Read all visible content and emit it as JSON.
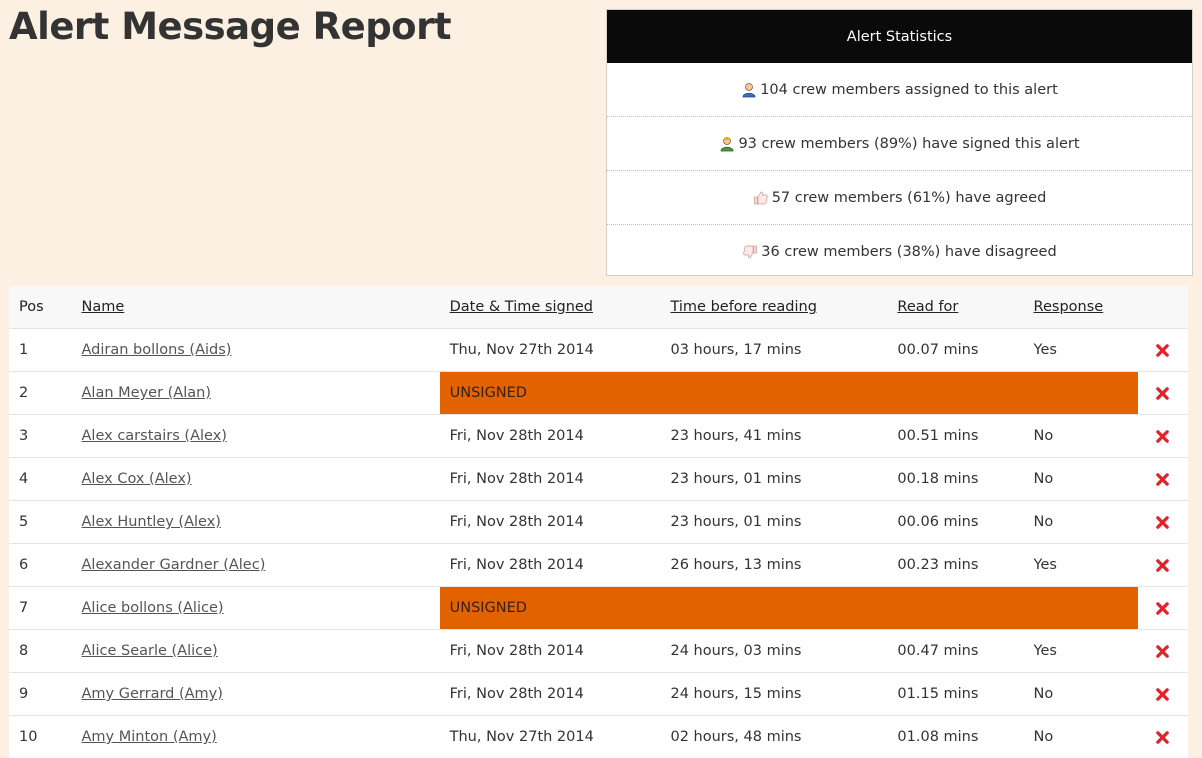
{
  "page": {
    "title": "Alert Message Report"
  },
  "stats": {
    "header": "Alert Statistics",
    "rows": [
      {
        "icon": "user-icon",
        "text": "104 crew members assigned to this alert"
      },
      {
        "icon": "signed-user-icon",
        "text": "93 crew members (89%) have signed this alert"
      },
      {
        "icon": "thumbs-up-icon",
        "text": "57 crew members (61%) have agreed"
      },
      {
        "icon": "thumbs-down-icon",
        "text": "36 crew members (38%) have disagreed"
      }
    ]
  },
  "table": {
    "columns": [
      "Pos",
      "Name",
      "Date & Time signed",
      "Time before reading",
      "Read for",
      "Response"
    ],
    "unsigned_label": "UNSIGNED",
    "rows": [
      {
        "pos": "1",
        "name": "Adiran bollons (Aids)",
        "date": "Thu, Nov 27th 2014",
        "before": "03 hours, 17 mins",
        "read": "00.07 mins",
        "response": "Yes"
      },
      {
        "pos": "2",
        "name": "Alan Meyer (Alan)",
        "unsigned": true
      },
      {
        "pos": "3",
        "name": "Alex carstairs (Alex)",
        "date": "Fri, Nov 28th 2014",
        "before": "23 hours, 41 mins",
        "read": "00.51 mins",
        "response": "No"
      },
      {
        "pos": "4",
        "name": "Alex Cox (Alex)",
        "date": "Fri, Nov 28th 2014",
        "before": "23 hours, 01 mins",
        "read": "00.18 mins",
        "response": "No"
      },
      {
        "pos": "5",
        "name": "Alex Huntley (Alex)",
        "date": "Fri, Nov 28th 2014",
        "before": "23 hours, 01 mins",
        "read": "00.06 mins",
        "response": "No"
      },
      {
        "pos": "6",
        "name": "Alexander Gardner (Alec)",
        "date": "Fri, Nov 28th 2014",
        "before": "26 hours, 13 mins",
        "read": "00.23 mins",
        "response": "Yes"
      },
      {
        "pos": "7",
        "name": "Alice bollons (Alice)",
        "unsigned": true
      },
      {
        "pos": "8",
        "name": "Alice Searle (Alice)",
        "date": "Fri, Nov 28th 2014",
        "before": "24 hours, 03 mins",
        "read": "00.47 mins",
        "response": "Yes"
      },
      {
        "pos": "9",
        "name": "Amy Gerrard (Amy)",
        "date": "Fri, Nov 28th 2014",
        "before": "24 hours, 15 mins",
        "read": "01.15 mins",
        "response": "No"
      },
      {
        "pos": "10",
        "name": "Amy Minton (Amy)",
        "date": "Thu, Nov 27th 2014",
        "before": "02 hours, 48 mins",
        "read": "01.08 mins",
        "response": "No"
      }
    ]
  },
  "colors": {
    "unsigned_bg": "#e36200",
    "delete_icon": "#e0242b",
    "page_bg": "#fbf0e2"
  }
}
